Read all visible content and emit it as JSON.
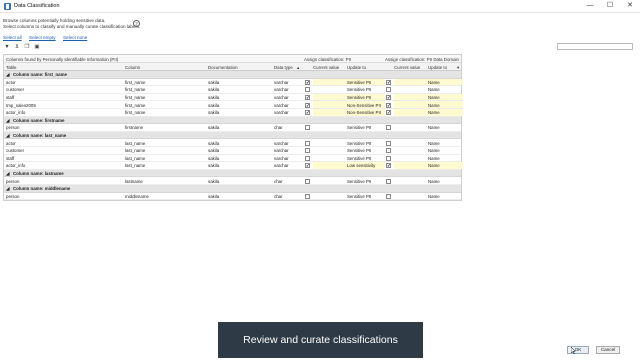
{
  "window": {
    "title": "Data Classification",
    "minimize": "—",
    "maximize": "☐",
    "close": "✕"
  },
  "description": {
    "line1": "Browse columns potentially holding sensitive data.",
    "line2": "Select columns to classify and manually curate classification labels.",
    "help": "?"
  },
  "links": {
    "select_all": "Select all",
    "select_empty": "Select empty",
    "select_none": "Select none"
  },
  "toolbar": {
    "icons": [
      "filter-icon",
      "filter-add-icon",
      "copy-icon",
      "paste-icon"
    ]
  },
  "grid": {
    "group_headers": {
      "columns": "Columns found by Personally Identifiable Information (PII)",
      "assign_pii": "Assign classification: PII",
      "assign_domain": "Assign classification: PII Data Domain"
    },
    "columns": {
      "table": "Table",
      "column": "Column",
      "documentation": "Documentation",
      "data_type": "Data type",
      "current_value": "Current value",
      "update_to": "Update to",
      "current_value2": "Current value",
      "update_to2": "Update to"
    },
    "rows": [
      {
        "group": "Column name: first_name"
      },
      {
        "table": "actor",
        "column": "first_name",
        "doc": "sakila",
        "type": "varchar",
        "pii_checked": true,
        "pii": "Sensitive PII",
        "dom_checked": true,
        "dom": "Name"
      },
      {
        "table": "customer",
        "column": "first_name",
        "doc": "sakila",
        "type": "varchar",
        "pii_checked": false,
        "pii": "Sensitive PII",
        "dom_checked": false,
        "dom": "Name"
      },
      {
        "table": "staff",
        "column": "first_name",
        "doc": "sakila",
        "type": "varchar",
        "pii_checked": true,
        "pii": "Sensitive PII",
        "dom_checked": true,
        "dom": "Name"
      },
      {
        "table": "tmp_sales2009",
        "column": "first_name",
        "doc": "sakila",
        "type": "varchar",
        "pii_checked": true,
        "pii": "Non-Sensitive PII",
        "dom_checked": true,
        "dom": "Name"
      },
      {
        "table": "actor_info",
        "column": "first_name",
        "doc": "sakila",
        "type": "varchar",
        "pii_checked": true,
        "pii": "Non-Sensitive PII",
        "dom_checked": true,
        "dom": "Name"
      },
      {
        "group": "Column name: firstname"
      },
      {
        "table": "person",
        "column": "firstname",
        "doc": "sakila",
        "type": "char",
        "pii_checked": false,
        "pii": "Sensitive PII",
        "dom_checked": false,
        "dom": "Name"
      },
      {
        "group": "Column name: last_name"
      },
      {
        "table": "actor",
        "column": "last_name",
        "doc": "sakila",
        "type": "varchar",
        "pii_checked": false,
        "pii": "Sensitive PII",
        "dom_checked": false,
        "dom": "Name"
      },
      {
        "table": "customer",
        "column": "last_name",
        "doc": "sakila",
        "type": "varchar",
        "pii_checked": false,
        "pii": "Sensitive PII",
        "dom_checked": false,
        "dom": "Name"
      },
      {
        "table": "staff",
        "column": "last_name",
        "doc": "sakila",
        "type": "varchar",
        "pii_checked": false,
        "pii": "Sensitive PII",
        "dom_checked": false,
        "dom": "Name"
      },
      {
        "table": "actor_info",
        "column": "last_name",
        "doc": "sakila",
        "type": "varchar",
        "pii_checked": true,
        "pii": "Low sensitivity",
        "dom_checked": true,
        "dom": "Name"
      },
      {
        "group": "Column name: lastname"
      },
      {
        "table": "person",
        "column": "lastname",
        "doc": "sakila",
        "type": "char",
        "pii_checked": false,
        "pii": "Sensitive PII",
        "dom_checked": false,
        "dom": "Name"
      },
      {
        "group": "Column name: middlename"
      },
      {
        "table": "person",
        "column": "middlename",
        "doc": "sakila",
        "type": "char",
        "pii_checked": false,
        "pii": "Sensitive PII",
        "dom_checked": false,
        "dom": "Name"
      }
    ]
  },
  "caption": "Review and curate classifications",
  "buttons": {
    "ok": "OK",
    "cancel": "Cancel"
  },
  "colors": {
    "highlight": "#fffbd0",
    "link": "#1a5fb4",
    "caption_bg": "#2f3a47"
  }
}
